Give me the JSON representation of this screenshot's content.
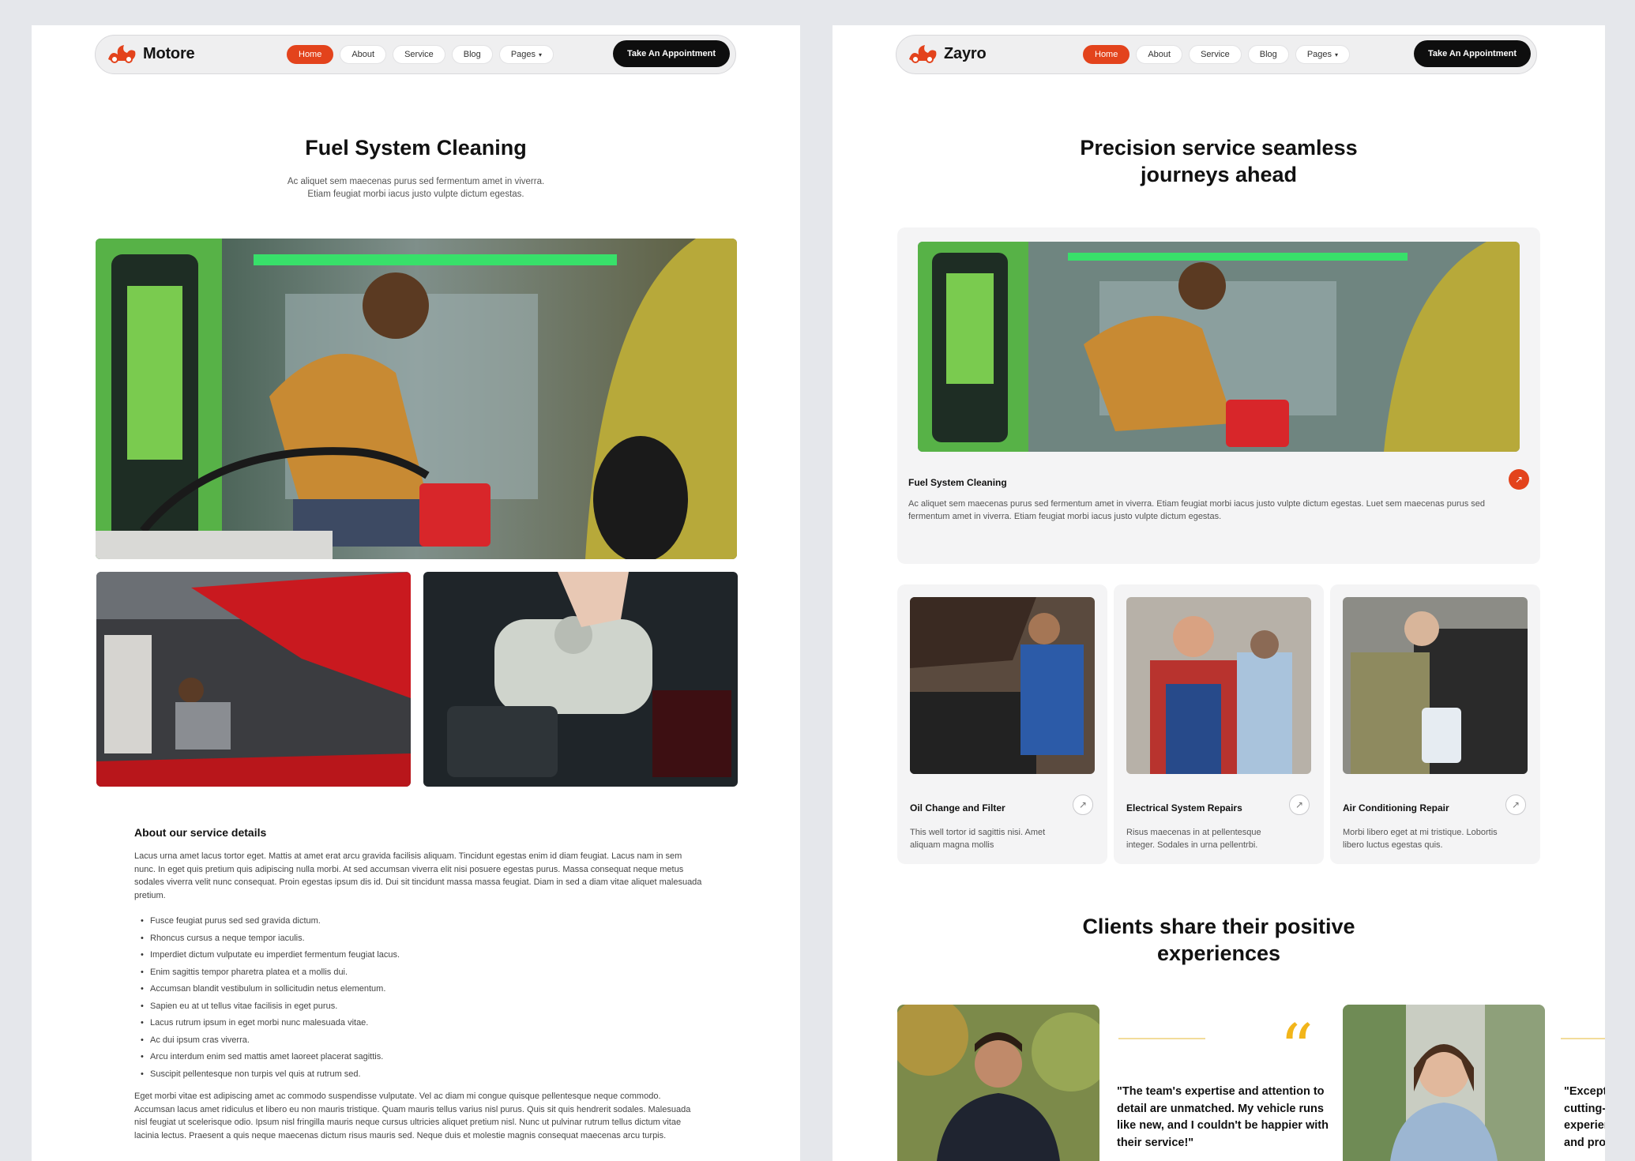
{
  "left": {
    "brand": "Motore",
    "nav": [
      "Home",
      "About",
      "Service",
      "Blog",
      "Pages"
    ],
    "cta": "Take An Appointment",
    "title": "Fuel System Cleaning",
    "subtitle_lines": [
      "Ac aliquet sem maecenas purus sed fermentum amet in viverra.",
      "Etiam feugiat morbi iacus justo vulpte dictum egestas."
    ],
    "about_heading": "About our service details",
    "about_para": "Lacus urna amet lacus tortor eget. Mattis at amet erat arcu gravida facilisis aliquam. Tincidunt egestas enim id diam feugiat. Lacus nam in sem nunc. In eget quis pretium quis adipiscing nulla morbi. At sed accumsan viverra elit nisi posuere egestas purus. Massa consequat neque metus sodales viverra velit nunc consequat. Proin egestas ipsum dis id. Dui sit tincidunt massa massa feugiat. Diam in sed a diam vitae aliquet malesuada pretium.",
    "bullets": [
      "Fusce feugiat purus sed sed gravida dictum.",
      "Rhoncus cursus a neque tempor iaculis.",
      "Imperdiet dictum vulputate eu imperdiet fermentum feugiat lacus.",
      "Enim sagittis tempor pharetra platea et a mollis dui.",
      "Accumsan blandit vestibulum in sollicitudin netus elementum.",
      "Sapien eu at ut tellus vitae facilisis in eget purus.",
      "Lacus rutrum ipsum in eget morbi nunc malesuada vitae.",
      "Ac dui ipsum cras viverra.",
      "Arcu interdum enim sed mattis amet laoreet placerat sagittis.",
      "Suscipit pellentesque non turpis vel quis at rutrum sed."
    ],
    "closing_para": "Eget morbi vitae est adipiscing amet ac commodo suspendisse vulputate. Vel ac diam mi congue quisque pellentesque neque commodo. Accumsan lacus amet ridiculus et libero eu non mauris tristique. Quam mauris tellus varius nisl purus. Quis sit quis hendrerit sodales. Malesuada nisl feugiat ut scelerisque odio. Ipsum nisl fringilla mauris neque cursus ultricies aliquet pretium nisl. Nunc ut pulvinar rutrum tellus dictum vitae lacinia lectus. Praesent a quis neque maecenas dictum risus mauris sed. Neque duis et molestie magnis consequat maecenas arcu turpis."
  },
  "right": {
    "brand": "Zayro",
    "nav": [
      "Home",
      "About",
      "Service",
      "Blog",
      "Pages"
    ],
    "cta": "Take An Appointment",
    "title_lines": [
      "Precision service seamless",
      "journeys ahead"
    ],
    "feature": {
      "title": "Fuel System Cleaning",
      "desc": "Ac aliquet sem maecenas purus sed fermentum amet in viverra. Etiam feugiat morbi iacus justo vulpte dictum egestas. Luet sem maecenas purus sed fermentum amet in viverra. Etiam feugiat morbi iacus justo vulpte dictum egestas."
    },
    "services": [
      {
        "title": "Oil Change and Filter",
        "desc": "This well tortor id sagittis nisi. Amet aliquam magna mollis"
      },
      {
        "title": "Electrical System Repairs",
        "desc": "Risus maecenas in at pellentesque integer. Sodales in urna pellentrbi."
      },
      {
        "title": "Air Conditioning Repair",
        "desc": "Morbi libero eget at mi tristique. Lobortis libero luctus egestas quis."
      }
    ],
    "testimonials_title_lines": [
      "Clients share their positive",
      "experiences"
    ],
    "quote1_lines": [
      "\"The team's expertise and attention to",
      "detail are unmatched. My vehicle runs",
      "like new, and I couldn't be happier with",
      "their service!\""
    ],
    "quote2_lines": [
      "\"Excepti",
      "cutting-e",
      "experien",
      "and prof"
    ]
  },
  "colors": {
    "accent": "#e3431c",
    "dark": "#0e0e0e",
    "quote_yellow": "#f2b51a",
    "card_bg": "#f4f4f5",
    "page_bg": "#e5e7eb"
  },
  "icons": {
    "logo": "flame-car-logo",
    "dropdown": "chevron-down-icon",
    "arrow": "arrow-up-right-icon",
    "quote": "quote-icon"
  }
}
